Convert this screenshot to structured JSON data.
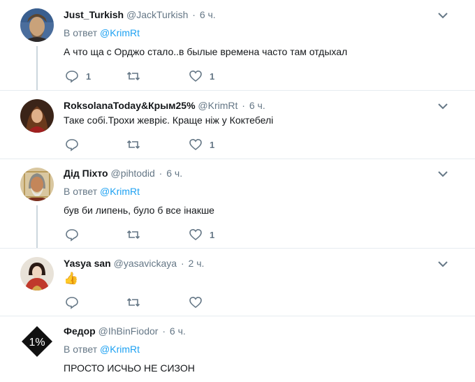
{
  "tweets": [
    {
      "name": "Just_Turkish",
      "handle": "@JackTurkish",
      "time": "6 ч.",
      "reply_prefix": "В ответ",
      "reply_to": "@KrimRt",
      "text": "А что ща с Орджо стало..в былые времена часто там отдыхал",
      "replies": "1",
      "retweets": "",
      "likes": "1"
    },
    {
      "name": "RoksolanaToday&Крым25%",
      "handle": "@KrimRt",
      "time": "6 ч.",
      "text": "Таке собі.Трохи жевріє. Краще ніж у Коктебелі",
      "replies": "",
      "retweets": "",
      "likes": "1"
    },
    {
      "name": "Дід Піхто",
      "handle": "@pihtodid",
      "time": "6 ч.",
      "reply_prefix": "В ответ",
      "reply_to": "@KrimRt",
      "text": "був би липень, було б все інакше",
      "replies": "",
      "retweets": "",
      "likes": "1"
    },
    {
      "name": "Yasya san",
      "handle": "@yasavickaya",
      "time": "2 ч.",
      "text": "👍",
      "replies": "",
      "retweets": "",
      "likes": ""
    },
    {
      "name": "Федор",
      "handle": "@IhBinFiodor",
      "time": "6 ч.",
      "reply_prefix": "В ответ",
      "reply_to": "@KrimRt",
      "text": "ПРОСТО ИСЧЬО НЕ СИЗОН",
      "avatar_text": "1%"
    }
  ],
  "colors": {
    "link": "#1da1f2",
    "muted": "#657786",
    "text": "#14171a",
    "separator": "#e6ecf0",
    "thread_line": "#ccd6dd"
  }
}
